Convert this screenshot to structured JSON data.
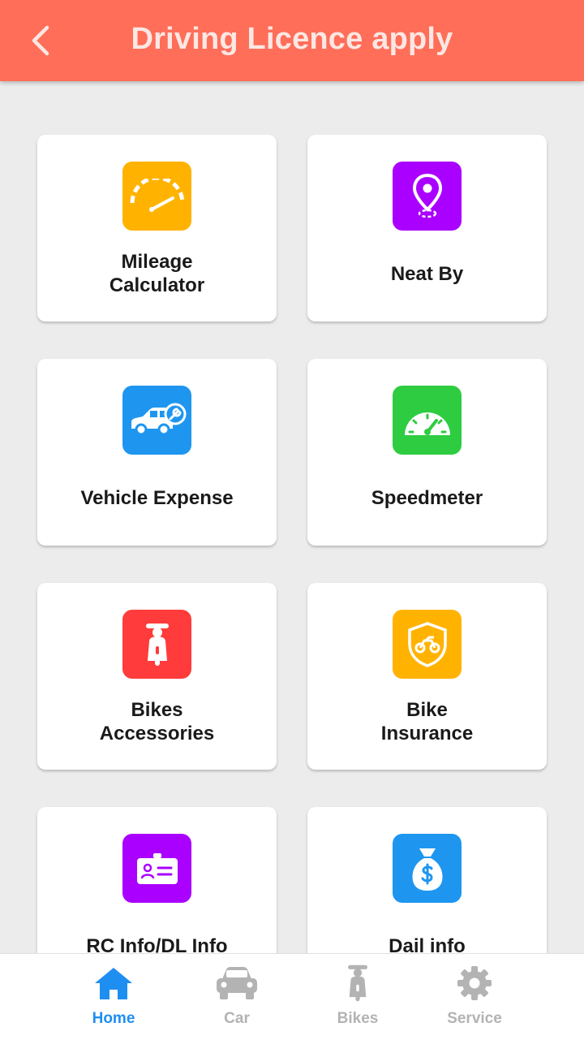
{
  "header": {
    "title": "Driving Licence apply"
  },
  "cards": [
    {
      "label": "Mileage\nCalculator",
      "icon": "gauge-icon",
      "color": "#ffb300"
    },
    {
      "label": "Neat By",
      "icon": "location-pin-icon",
      "color": "#aa00ff"
    },
    {
      "label": "Vehicle Expense",
      "icon": "car-service-icon",
      "color": "#1e96f0"
    },
    {
      "label": "Speedmeter",
      "icon": "speedometer-icon",
      "color": "#2ecc40"
    },
    {
      "label": "Bikes\nAccessories",
      "icon": "scooter-icon",
      "color": "#ff3b3b"
    },
    {
      "label": "Bike\nInsurance",
      "icon": "bike-shield-icon",
      "color": "#ffb300"
    },
    {
      "label": "RC Info/DL Info",
      "icon": "id-card-icon",
      "color": "#aa00ff"
    },
    {
      "label": "Dail info",
      "icon": "money-bag-icon",
      "color": "#1e96f0"
    }
  ],
  "nav": [
    {
      "label": "Home",
      "icon": "home-icon",
      "active": true
    },
    {
      "label": "Car",
      "icon": "car-icon",
      "active": false
    },
    {
      "label": "Bikes",
      "icon": "scooter-icon",
      "active": false
    },
    {
      "label": "Service",
      "icon": "gear-icon",
      "active": false
    }
  ],
  "colors": {
    "appbar": "#ff6e59",
    "active_nav": "#1f8ef1",
    "inactive_nav": "#b3b3b3"
  }
}
